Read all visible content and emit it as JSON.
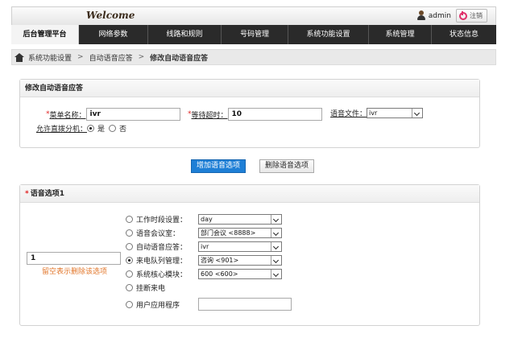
{
  "header": {
    "welcome": "Welcome",
    "username": "admin",
    "logout_label": "注销"
  },
  "nav": {
    "items": [
      {
        "label": "后台管理平台",
        "active": true
      },
      {
        "label": "网络参数"
      },
      {
        "label": "线路和规则"
      },
      {
        "label": "号码管理"
      },
      {
        "label": "系统功能设置"
      },
      {
        "label": "系统管理"
      },
      {
        "label": "状态信息"
      }
    ]
  },
  "breadcrumb": {
    "items": [
      "系统功能设置",
      "自动语音应答"
    ],
    "separator": ">",
    "current": "修改自动语音应答"
  },
  "edit_panel": {
    "title": "修改自动语音应答",
    "menu_name_label": "菜单名称：",
    "menu_name_value": "ivr",
    "wait_timeout_label": "等待超时：",
    "wait_timeout_value": "10",
    "voice_file_label": "语音文件：",
    "voice_file_value": "ivr",
    "allow_direct_label": "允许直拨分机：",
    "yes_label": "是",
    "no_label": "否",
    "allow_direct_selected": "yes"
  },
  "actions": {
    "add_option_label": "增加语音选项",
    "delete_option_label": "删除语音选项"
  },
  "option_panel": {
    "title": "语音选项1",
    "key_value": "1",
    "hint": "留空表示删除该选项",
    "selected_target": "queue",
    "targets": {
      "worktime": {
        "label": "工作时段设置：",
        "value": "day"
      },
      "conference": {
        "label": "语音会议室：",
        "value": "部门会议 <8888>"
      },
      "ivr": {
        "label": "自动语音应答：",
        "value": "ivr"
      },
      "queue": {
        "label": "来电队列管理：",
        "value": "咨询 <901>"
      },
      "core": {
        "label": "系统核心模块：",
        "value": "600 <600>"
      },
      "hangup": {
        "label": "挂断来电"
      },
      "userapp": {
        "label": "用户应用程序",
        "value": ""
      }
    }
  },
  "colors": {
    "nav_bg": "#2a2a2a",
    "primary_button": "#1e7fd6",
    "required_mark": "#e02020",
    "hint": "#e2762a"
  }
}
